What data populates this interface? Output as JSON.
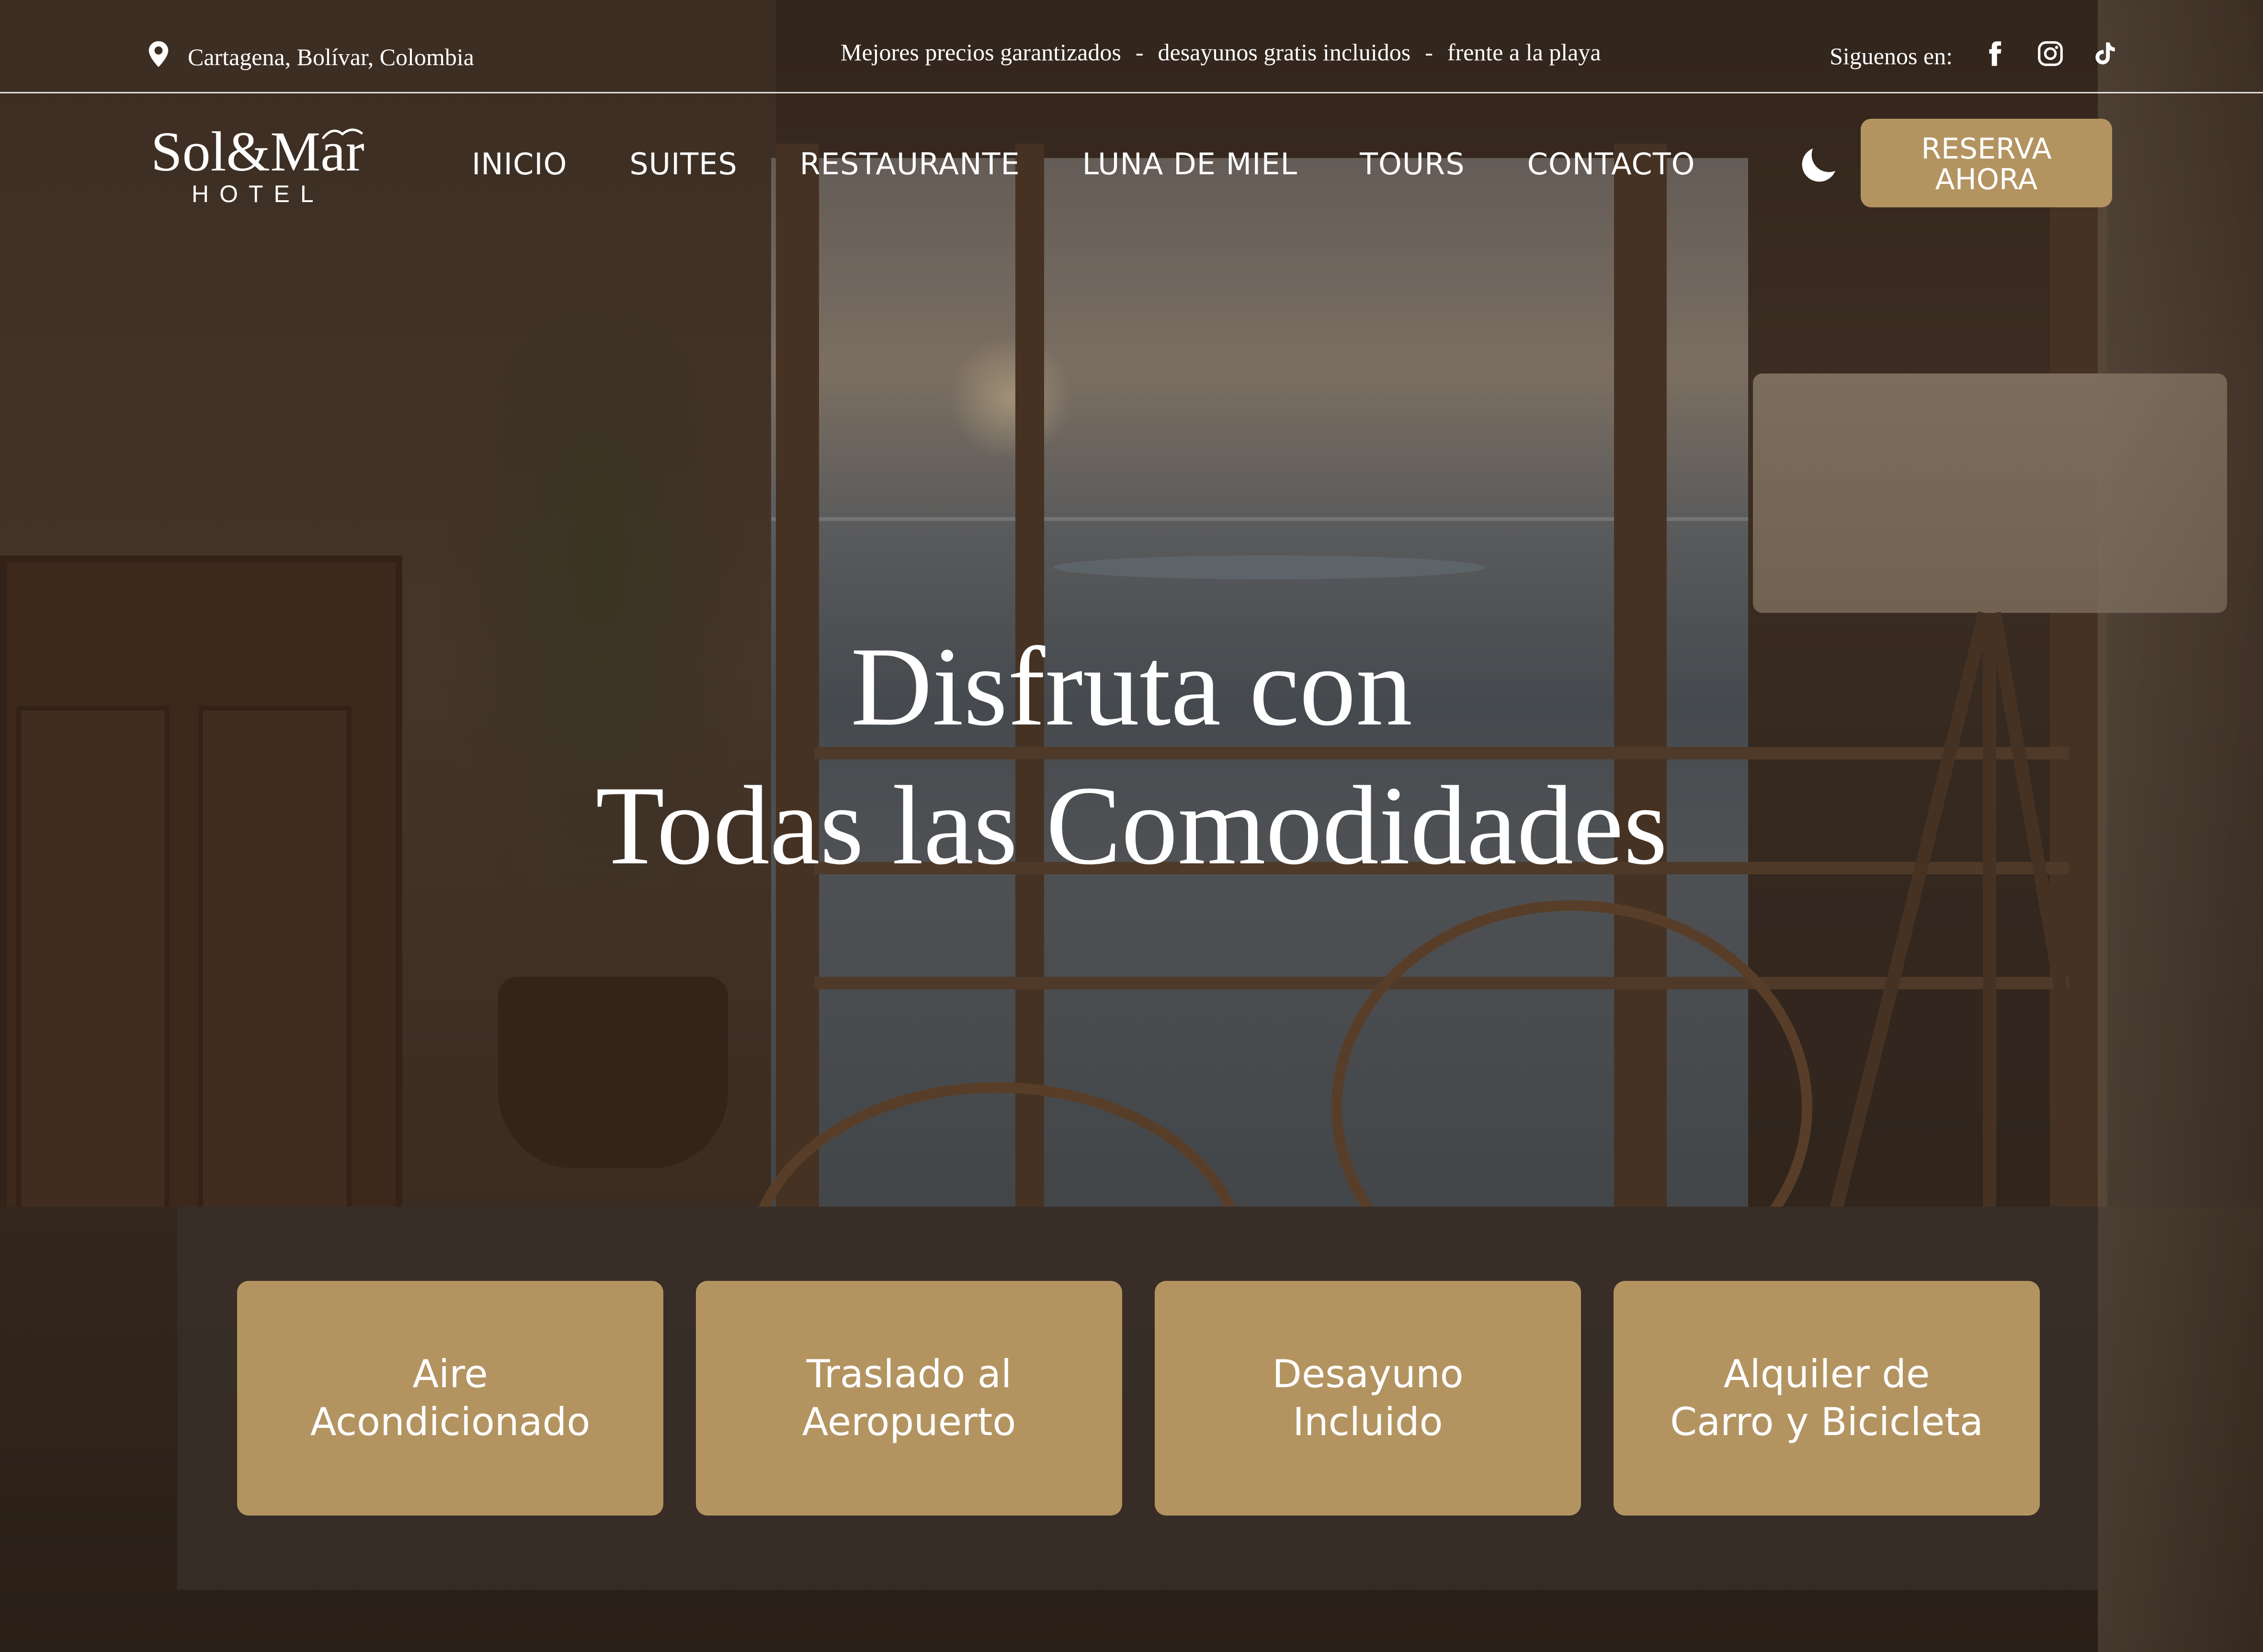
{
  "topbar": {
    "location": "Cartagena, Bolívar, Colombia",
    "tagline_parts": [
      "Mejores precios garantizados",
      "-",
      "desayunos gratis incluidos",
      "-",
      "frente a la playa"
    ],
    "social_label": "Siguenos en:",
    "social_icons": [
      "facebook-icon",
      "instagram-icon",
      "tiktok-icon"
    ]
  },
  "logo": {
    "brand": "Sol&Mar",
    "sub": "HOTEL"
  },
  "nav": {
    "items": [
      "INICIO",
      "SUITES",
      "RESTAURANTE",
      "LUNA DE MIEL",
      "TOURS",
      "CONTACTO"
    ],
    "theme_toggle_icon": "moon-icon",
    "cta": "RESERVA\nAHORA"
  },
  "hero": {
    "title_line1": "Disfruta con",
    "title_line2": "Todas las Comodidades"
  },
  "amenities": [
    "Aire\nAcondicionado",
    "Traslado al\nAeropuerto",
    "Desayuno\nIncluido",
    "Alquiler de\nCarro y Bicicleta"
  ],
  "colors": {
    "accent": "#b39461",
    "text": "#ffffff",
    "panel": "#3a302a"
  }
}
